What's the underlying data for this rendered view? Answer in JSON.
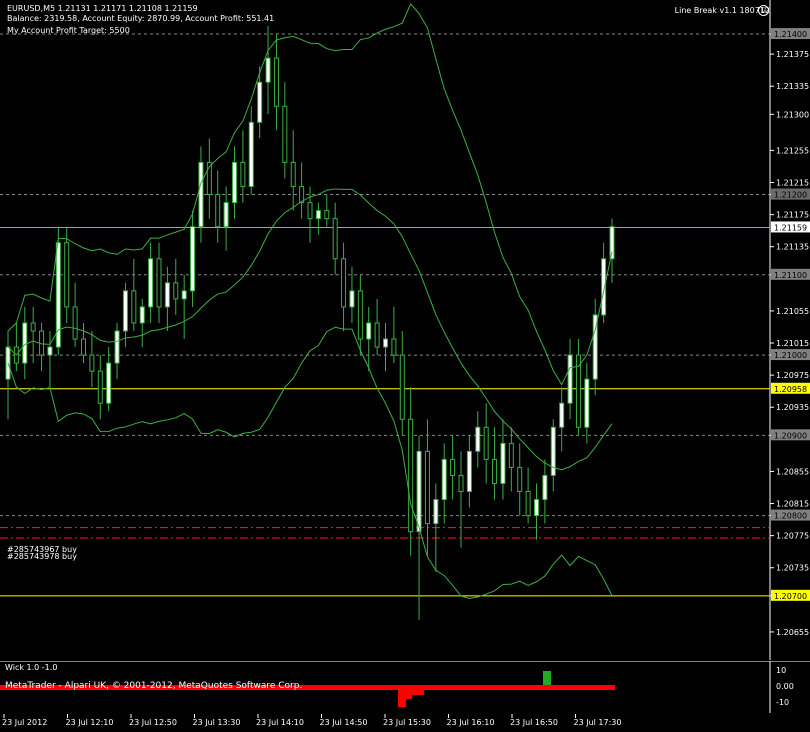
{
  "header": {
    "title": "EURUSD,M5  1.21131 1.21171 1.21108 1.21159",
    "account": "Balance: 2319.58, Account Equity: 2870.99, Account Profit: 551.41",
    "target": "My Account Profit Target: 5500",
    "ea_label": "Line Break  v1.1 180712"
  },
  "orders": [
    {
      "label": "#285743967 buy",
      "price": 1.20785
    },
    {
      "label": "#285743978 buy",
      "price": 1.20772
    }
  ],
  "price_axis": {
    "min": 1.2063,
    "max": 1.2142,
    "ticks": [
      "1.21400",
      "1.21375",
      "1.21335",
      "1.21300",
      "1.21255",
      "1.21215",
      "1.21200",
      "1.21175",
      "1.21135",
      "1.21100",
      "1.21055",
      "1.21015",
      "1.21000",
      "1.20975",
      "1.20935",
      "1.20900",
      "1.20855",
      "1.20815",
      "1.20800",
      "1.20775",
      "1.20735",
      "1.20700",
      "1.20655"
    ],
    "highlight": [
      {
        "value": "1.21400",
        "style": "gray"
      },
      {
        "value": "1.21200",
        "style": "gray"
      },
      {
        "value": "1.21200",
        "style": "gray2"
      },
      {
        "value": "1.21159",
        "style": "white"
      },
      {
        "value": "1.21100",
        "style": "gray"
      },
      {
        "value": "1.21000",
        "style": "gray"
      },
      {
        "value": "1.20958",
        "style": "yellow"
      },
      {
        "value": "1.20900",
        "style": "gray"
      },
      {
        "value": "1.20800",
        "style": "gray"
      },
      {
        "value": "1.20700",
        "style": "yellow"
      }
    ]
  },
  "levels": {
    "bid": 1.21159,
    "yellow_upper": 1.20958,
    "yellow_lower": 1.207,
    "dashed": [
      1.214,
      1.212,
      1.211,
      1.21,
      1.209,
      1.208
    ]
  },
  "time_axis": [
    "23 Jul 2012",
    "23 Jul 12:10",
    "23 Jul 12:50",
    "23 Jul 13:30",
    "23 Jul 14:10",
    "23 Jul 14:50",
    "23 Jul 15:30",
    "23 Jul 16:10",
    "23 Jul 16:50",
    "23 Jul 17:30"
  ],
  "indicator": {
    "title": "Wick 1.0 -1.0",
    "copyright": "MetaTrader - Alpari UK, © 2001-2012, MetaQuotes Software Corp.",
    "scale": [
      "10",
      "0.00",
      "-10"
    ]
  },
  "chart_data": {
    "type": "candlestick",
    "symbol": "EURUSD",
    "timeframe": "M5",
    "candles": [
      [
        1.2097,
        1.2103,
        1.2092,
        1.2101
      ],
      [
        1.2101,
        1.2104,
        1.2098,
        1.2099
      ],
      [
        1.2099,
        1.2106,
        1.2097,
        1.2104
      ],
      [
        1.2104,
        1.2106,
        1.2099,
        1.2103
      ],
      [
        1.2103,
        1.2104,
        1.2098,
        1.21
      ],
      [
        1.21,
        1.2103,
        1.2096,
        1.2101
      ],
      [
        1.2101,
        1.2116,
        1.21,
        1.2114
      ],
      [
        1.2114,
        1.2116,
        1.2104,
        1.2106
      ],
      [
        1.2106,
        1.2109,
        1.2101,
        1.2102
      ],
      [
        1.2102,
        1.2104,
        1.2099,
        1.21
      ],
      [
        1.21,
        1.2103,
        1.2096,
        1.2098
      ],
      [
        1.2098,
        1.21,
        1.2092,
        1.2094
      ],
      [
        1.2094,
        1.2101,
        1.2093,
        1.2099
      ],
      [
        1.2099,
        1.2104,
        1.2097,
        1.2103
      ],
      [
        1.2103,
        1.2109,
        1.2101,
        1.2108
      ],
      [
        1.2108,
        1.2112,
        1.2103,
        1.2104
      ],
      [
        1.2104,
        1.2107,
        1.2101,
        1.2106
      ],
      [
        1.2106,
        1.2114,
        1.2104,
        1.2112
      ],
      [
        1.2112,
        1.2114,
        1.2104,
        1.2106
      ],
      [
        1.2106,
        1.2111,
        1.2103,
        1.2109
      ],
      [
        1.2109,
        1.2112,
        1.2105,
        1.2107
      ],
      [
        1.2107,
        1.211,
        1.2102,
        1.2108
      ],
      [
        1.2108,
        1.2118,
        1.2106,
        1.2116
      ],
      [
        1.2116,
        1.2126,
        1.2114,
        1.2124
      ],
      [
        1.2124,
        1.2127,
        1.2117,
        1.212
      ],
      [
        1.212,
        1.2123,
        1.2114,
        1.2116
      ],
      [
        1.2116,
        1.2121,
        1.2113,
        1.2119
      ],
      [
        1.2119,
        1.2126,
        1.2117,
        1.2124
      ],
      [
        1.2124,
        1.2128,
        1.2119,
        1.2121
      ],
      [
        1.2121,
        1.2131,
        1.212,
        1.2129
      ],
      [
        1.2129,
        1.2136,
        1.2127,
        1.2134
      ],
      [
        1.2134,
        1.2141,
        1.213,
        1.2137
      ],
      [
        1.2137,
        1.214,
        1.2128,
        1.2131
      ],
      [
        1.2131,
        1.2134,
        1.2122,
        1.2124
      ],
      [
        1.2124,
        1.2128,
        1.2118,
        1.2121
      ],
      [
        1.2121,
        1.2124,
        1.2117,
        1.2119
      ],
      [
        1.2119,
        1.2121,
        1.2114,
        1.2117
      ],
      [
        1.2117,
        1.2119,
        1.2115,
        1.2118
      ],
      [
        1.2118,
        1.212,
        1.2116,
        1.2117
      ],
      [
        1.2117,
        1.2119,
        1.211,
        1.2112
      ],
      [
        1.2112,
        1.2114,
        1.2103,
        1.2106
      ],
      [
        1.2106,
        1.2111,
        1.2104,
        1.2108
      ],
      [
        1.2108,
        1.211,
        1.21,
        1.2102
      ],
      [
        1.2102,
        1.2106,
        1.2098,
        1.2104
      ],
      [
        1.2104,
        1.2107,
        1.21,
        1.2101
      ],
      [
        1.2101,
        1.2104,
        1.2098,
        1.2102
      ],
      [
        1.2102,
        1.2106,
        1.2099,
        1.21
      ],
      [
        1.21,
        1.2103,
        1.209,
        1.2092
      ],
      [
        1.2092,
        1.2096,
        1.2075,
        1.2078
      ],
      [
        1.2078,
        1.209,
        1.2067,
        1.2088
      ],
      [
        1.2088,
        1.2092,
        1.2075,
        1.2079
      ],
      [
        1.2079,
        1.2084,
        1.2073,
        1.2082
      ],
      [
        1.2082,
        1.2089,
        1.2079,
        1.2087
      ],
      [
        1.2087,
        1.209,
        1.2082,
        1.2085
      ],
      [
        1.2085,
        1.2088,
        1.2076,
        1.2083
      ],
      [
        1.2083,
        1.209,
        1.2081,
        1.2088
      ],
      [
        1.2088,
        1.2093,
        1.2086,
        1.2091
      ],
      [
        1.2091,
        1.2094,
        1.2084,
        1.2087
      ],
      [
        1.2087,
        1.2091,
        1.2082,
        1.2084
      ],
      [
        1.2084,
        1.2092,
        1.2082,
        1.2089
      ],
      [
        1.2089,
        1.2091,
        1.2083,
        1.2086
      ],
      [
        1.2086,
        1.2089,
        1.208,
        1.2083
      ],
      [
        1.2083,
        1.2086,
        1.2079,
        1.208
      ],
      [
        1.208,
        1.2084,
        1.2077,
        1.2082
      ],
      [
        1.2082,
        1.2087,
        1.2079,
        1.2085
      ],
      [
        1.2085,
        1.2092,
        1.2083,
        1.2091
      ],
      [
        1.2091,
        1.2096,
        1.2088,
        1.2094
      ],
      [
        1.2094,
        1.2102,
        1.2092,
        1.21
      ],
      [
        1.21,
        1.2102,
        1.209,
        1.2091
      ],
      [
        1.2091,
        1.2099,
        1.2089,
        1.2097
      ],
      [
        1.2097,
        1.2107,
        1.2095,
        1.2105
      ],
      [
        1.2105,
        1.2114,
        1.2104,
        1.2112
      ],
      [
        1.2112,
        1.2117,
        1.2109,
        1.2116
      ]
    ]
  }
}
